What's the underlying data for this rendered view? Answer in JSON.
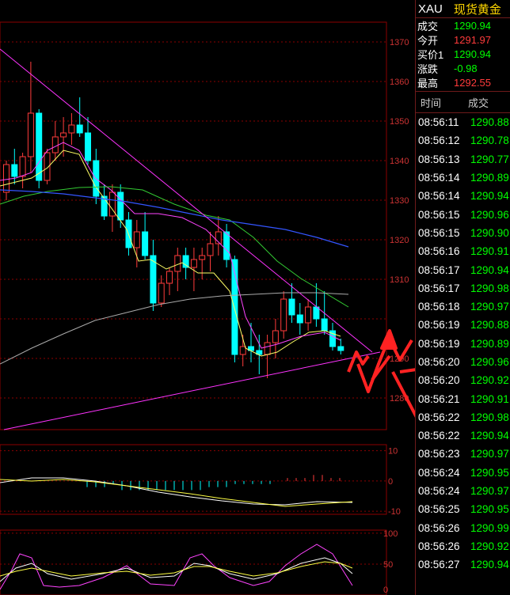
{
  "panel": {
    "symbol": "XAU",
    "name": "现货黄金",
    "quotes": [
      {
        "label": "成交",
        "value": "1290.94",
        "color": "#00ff00"
      },
      {
        "label": "今开",
        "value": "1291.97",
        "color": "#ff3b3b"
      },
      {
        "label": "买价1",
        "value": "1290.94",
        "color": "#00ff00"
      },
      {
        "label": "涨跌",
        "value": "-0.98",
        "color": "#00ff00"
      },
      {
        "label": "最高",
        "value": "1292.55",
        "color": "#ff3b3b"
      }
    ],
    "ticks_header": {
      "time": "时间",
      "price": "成交"
    },
    "ticks": [
      {
        "time": "08:56:11",
        "price": "1290.88"
      },
      {
        "time": "08:56:12",
        "price": "1290.78"
      },
      {
        "time": "08:56:13",
        "price": "1290.77"
      },
      {
        "time": "08:56:14",
        "price": "1290.89"
      },
      {
        "time": "08:56:14",
        "price": "1290.94"
      },
      {
        "time": "08:56:15",
        "price": "1290.96"
      },
      {
        "time": "08:56:15",
        "price": "1290.90"
      },
      {
        "time": "08:56:16",
        "price": "1290.91"
      },
      {
        "time": "08:56:17",
        "price": "1290.94"
      },
      {
        "time": "08:56:17",
        "price": "1290.98"
      },
      {
        "time": "08:56:18",
        "price": "1290.97"
      },
      {
        "time": "08:56:19",
        "price": "1290.88"
      },
      {
        "time": "08:56:19",
        "price": "1290.89"
      },
      {
        "time": "08:56:20",
        "price": "1290.96"
      },
      {
        "time": "08:56:20",
        "price": "1290.92"
      },
      {
        "time": "08:56:21",
        "price": "1290.91"
      },
      {
        "time": "08:56:22",
        "price": "1290.98"
      },
      {
        "time": "08:56:22",
        "price": "1290.94"
      },
      {
        "time": "08:56:23",
        "price": "1290.97"
      },
      {
        "time": "08:56:24",
        "price": "1290.95"
      },
      {
        "time": "08:56:24",
        "price": "1290.97"
      },
      {
        "time": "08:56:25",
        "price": "1290.95"
      },
      {
        "time": "08:56:26",
        "price": "1290.99"
      },
      {
        "time": "08:56:26",
        "price": "1290.92"
      },
      {
        "time": "08:56:27",
        "price": "1290.94"
      }
    ]
  },
  "chart_data": [
    {
      "type": "candlestick",
      "y_ticks": [
        1370,
        1360,
        1350,
        1340,
        1330,
        1320,
        1310,
        1300,
        1290,
        1280
      ],
      "y_labels": [
        "1370",
        "1360",
        "1350",
        "1340",
        "1330",
        "1320",
        "1310",
        "",
        "1290",
        "1280"
      ],
      "ylim": [
        1272,
        1375
      ],
      "colors": {
        "up": "#ff3b3b",
        "down": "#00ffff",
        "grid": "#8b0000"
      },
      "candles": [
        [
          1332,
          1340,
          1330,
          1339
        ],
        [
          1339,
          1343,
          1334,
          1336
        ],
        [
          1336,
          1342,
          1333,
          1341
        ],
        [
          1341,
          1365,
          1337,
          1352
        ],
        [
          1352,
          1353,
          1333,
          1335
        ],
        [
          1335,
          1343,
          1334,
          1342
        ],
        [
          1342,
          1350,
          1340,
          1346
        ],
        [
          1346,
          1351,
          1341,
          1347
        ],
        [
          1347,
          1352,
          1344,
          1349
        ],
        [
          1349,
          1356,
          1346,
          1347
        ],
        [
          1347,
          1351,
          1339,
          1340
        ],
        [
          1340,
          1343,
          1329,
          1331
        ],
        [
          1331,
          1334,
          1325,
          1326
        ],
        [
          1326,
          1334,
          1322,
          1332
        ],
        [
          1332,
          1334,
          1323,
          1325
        ],
        [
          1325,
          1327,
          1316,
          1318
        ],
        [
          1318,
          1325,
          1313,
          1322
        ],
        [
          1322,
          1327,
          1315,
          1316
        ],
        [
          1316,
          1320,
          1302,
          1304
        ],
        [
          1304,
          1311,
          1303,
          1309
        ],
        [
          1309,
          1313,
          1306,
          1312
        ],
        [
          1312,
          1318,
          1307,
          1316
        ],
        [
          1316,
          1318,
          1310,
          1313
        ],
        [
          1313,
          1318,
          1307,
          1315
        ],
        [
          1315,
          1318,
          1310,
          1316
        ],
        [
          1316,
          1322,
          1312,
          1319
        ],
        [
          1319,
          1326,
          1316,
          1322
        ],
        [
          1322,
          1324,
          1313,
          1315
        ],
        [
          1315,
          1316,
          1289,
          1291
        ],
        [
          1291,
          1296,
          1288,
          1293
        ],
        [
          1293,
          1299,
          1289,
          1292
        ],
        [
          1292,
          1296,
          1286,
          1291
        ],
        [
          1291,
          1296,
          1285,
          1294
        ],
        [
          1294,
          1300,
          1290,
          1297
        ],
        [
          1297,
          1307,
          1295,
          1305
        ],
        [
          1305,
          1309,
          1299,
          1301
        ],
        [
          1301,
          1304,
          1296,
          1299
        ],
        [
          1299,
          1305,
          1297,
          1303
        ],
        [
          1303,
          1309,
          1298,
          1300
        ],
        [
          1300,
          1307,
          1296,
          1297
        ],
        [
          1297,
          1299,
          1292,
          1293
        ],
        [
          1293,
          1295,
          1291,
          1292
        ]
      ]
    },
    {
      "type": "bar",
      "y_ticks": [
        10,
        0,
        -10
      ],
      "ylim": [
        -11,
        12
      ],
      "values": [
        -2,
        -2,
        -2,
        -1,
        -3,
        -3,
        -3,
        -3,
        -3,
        -3,
        -3,
        -3,
        -3,
        -3,
        -2,
        -2,
        -2,
        -1,
        -1,
        -1,
        -1,
        -1,
        0,
        1,
        1,
        1,
        2,
        2,
        1,
        1,
        0
      ]
    },
    {
      "type": "line",
      "y_ticks": [
        100,
        50,
        0
      ],
      "ylim": [
        0,
        105
      ]
    }
  ]
}
